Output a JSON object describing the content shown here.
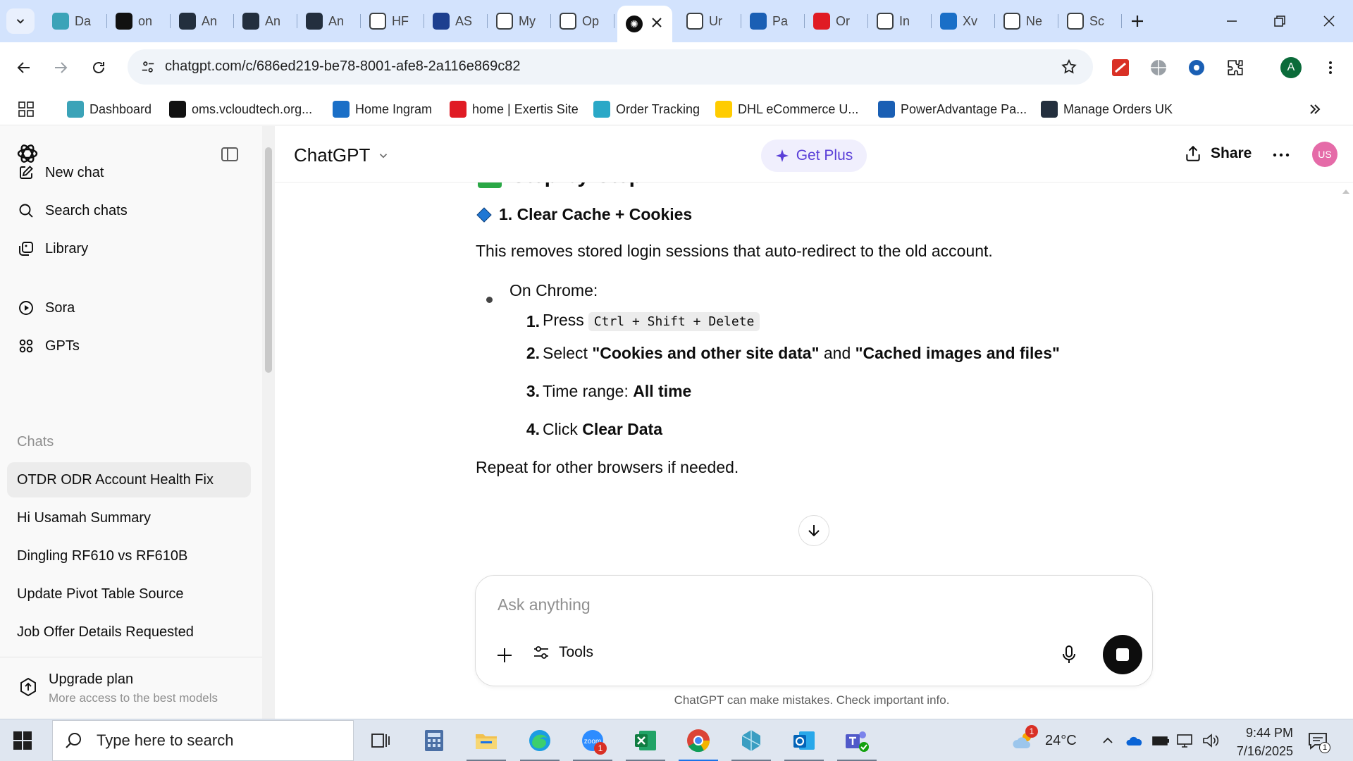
{
  "browser": {
    "tabs": [
      {
        "label": "Da",
        "icon": "ring-logo-icon",
        "color": "#3ba3b8"
      },
      {
        "label": "on",
        "icon": "triangle-logo-icon",
        "color": "#111111"
      },
      {
        "label": "An",
        "icon": "amazon-icon",
        "color": "#232f3e"
      },
      {
        "label": "An",
        "icon": "amazon-icon",
        "color": "#232f3e"
      },
      {
        "label": "An",
        "icon": "amazon-icon",
        "color": "#232f3e"
      },
      {
        "label": "HF",
        "icon": "amazon-icon",
        "color": "#ffffff"
      },
      {
        "label": "AS",
        "icon": "arrow-logo-icon",
        "color": "#1d3f8f"
      },
      {
        "label": "My",
        "icon": "dots-logo-icon",
        "color": "#ffffff"
      },
      {
        "label": "Op",
        "icon": "openai-icon",
        "color": "#ffffff"
      },
      {
        "label": "Ur",
        "icon": "globe-icon",
        "color": "#ffffff"
      },
      {
        "label": "Pa",
        "icon": "doc-logo-icon",
        "color": "#1a5fb4"
      },
      {
        "label": "Or",
        "icon": "exertis-icon",
        "color": "#e01b24"
      },
      {
        "label": "In",
        "icon": "c-logo-icon",
        "color": "#ffffff"
      },
      {
        "label": "Xv",
        "icon": "puzzle-logo-icon",
        "color": "#1a6fc7"
      },
      {
        "label": "Ne",
        "icon": "chrome-gray-icon",
        "color": "#ffffff"
      },
      {
        "label": "Sc",
        "icon": "s-logo-icon",
        "color": "#ffffff"
      }
    ],
    "url": "chatgpt.com/c/686ed219-be78-8001-afe8-2a116e869c82",
    "profile_initial": "A",
    "bookmarks": [
      {
        "label": "Dashboard",
        "icon": "ring-logo-icon",
        "color": "#3ba3b8"
      },
      {
        "label": "oms.vcloudtech.org...",
        "icon": "triangle-logo-icon",
        "color": "#111111"
      },
      {
        "label": "Home Ingram",
        "icon": "ingram-icon",
        "color": "#1a6fc7"
      },
      {
        "label": "home | Exertis Site",
        "icon": "exertis-icon",
        "color": "#e01b24"
      },
      {
        "label": "Order Tracking",
        "icon": "c-logo-icon",
        "color": "#2aa8c7"
      },
      {
        "label": "DHL eCommerce U...",
        "icon": "dhl-icon",
        "color": "#ffcc00"
      },
      {
        "label": "PowerAdvantage Pa...",
        "icon": "doc-logo-icon",
        "color": "#1a5fb4"
      },
      {
        "label": "Manage Orders UK",
        "icon": "amazon-icon",
        "color": "#232f3e"
      }
    ]
  },
  "sidebar": {
    "nav": [
      {
        "label": "New chat",
        "icon": "edit-icon"
      },
      {
        "label": "Search chats",
        "icon": "search-icon"
      },
      {
        "label": "Library",
        "icon": "library-icon"
      },
      {
        "label": "Sora",
        "icon": "play-icon"
      },
      {
        "label": "GPTs",
        "icon": "grid-icon"
      }
    ],
    "chats_heading": "Chats",
    "chats": [
      "OTDR ODR Account Health Fix",
      "Hi Usamah Summary",
      "Dingling RF610 vs RF610B",
      "Update Pivot Table Source",
      "Job Offer Details Requested"
    ],
    "upgrade_title": "Upgrade plan",
    "upgrade_subtitle": "More access to the best models"
  },
  "header": {
    "model": "ChatGPT",
    "get_plus": "Get Plus",
    "share": "Share",
    "avatar": "US"
  },
  "message": {
    "step_title": "Step-by-Step Fix:",
    "sub_title": "1. Clear Cache + Cookies",
    "intro": "This removes stored login sessions that auto-redirect to the old account.",
    "bullet": "On Chrome:",
    "steps": [
      {
        "num": "1.",
        "pre": "Press",
        "kbd": "Ctrl + Shift + Delete"
      },
      {
        "num": "2.",
        "pre": "Select ",
        "b1": "\"Cookies and other site data\"",
        "mid": " and ",
        "b2": "\"Cached images and files\""
      },
      {
        "num": "3.",
        "pre": "Time range: ",
        "b1": "All time"
      },
      {
        "num": "4.",
        "pre": "Click ",
        "b1": "Clear Data"
      }
    ],
    "outro": "Repeat for other browsers if needed."
  },
  "composer": {
    "placeholder": "Ask anything",
    "tools": "Tools",
    "disclaimer": "ChatGPT can make mistakes. Check important info."
  },
  "taskbar": {
    "search_placeholder": "Type here to search",
    "apps": [
      "task-view-icon",
      "calculator-icon",
      "file-explorer-icon",
      "edge-icon",
      "zoom-icon",
      "excel-icon",
      "chrome-icon",
      "app-icon",
      "outlook-icon",
      "teams-icon"
    ],
    "zoom_badge": "1",
    "weather_badge": "1",
    "temperature": "24°C",
    "time": "9:44 PM",
    "date": "7/16/2025",
    "notification_count": "1"
  },
  "colors": {
    "tabstrip": "#d3e3fd",
    "accent_purple": "#5a3fd8",
    "avatar_pink": "#e56ba8",
    "check_green": "#2aa846",
    "diamond_blue": "#1f77d4"
  }
}
